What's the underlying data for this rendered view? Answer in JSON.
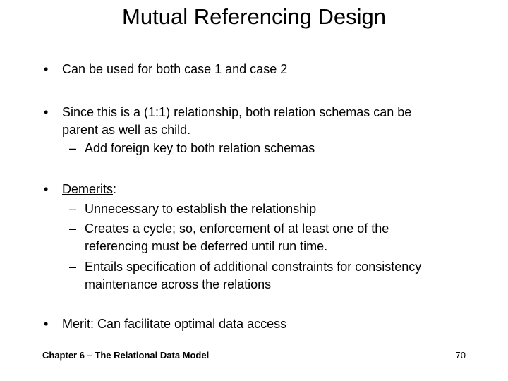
{
  "slide": {
    "title": "Mutual Referencing Design",
    "bullet_glyph": "•",
    "dash_glyph": "–",
    "bullets": [
      {
        "text": "Can be used for both case 1 and case 2"
      },
      {
        "line1": "Since this is a (1:1) relationship, both relation schemas can be",
        "line2": "parent as well as child.",
        "sub": [
          "Add foreign key to both relation schemas"
        ]
      },
      {
        "label": "Demerits",
        "label_suffix": ":",
        "sub": [
          {
            "line1": "Unnecessary to establish the relationship"
          },
          {
            "line1": "Creates a cycle; so, enforcement of at least one of the",
            "line2": "referencing must be deferred until run time."
          },
          {
            "line1": "Entails specification of additional constraints for consistency",
            "line2": "maintenance across the relations"
          }
        ]
      },
      {
        "label": "Merit",
        "rest": ": Can facilitate optimal data access"
      }
    ]
  },
  "footer": {
    "chapter": "Chapter 6 – The Relational Data Model",
    "page_number": "70"
  }
}
